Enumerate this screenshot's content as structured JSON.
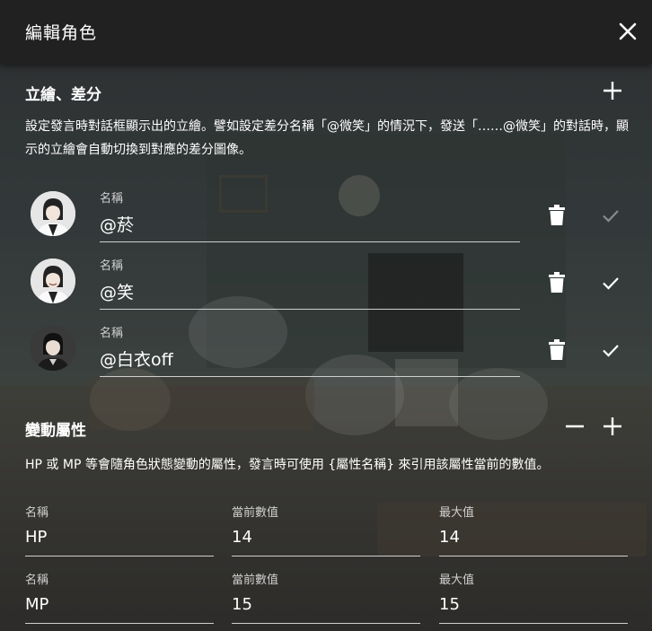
{
  "dialog": {
    "title": "編輯角色",
    "close_icon": "close-icon"
  },
  "sprites": {
    "title": "立繪、差分",
    "add_icon": "plus-icon",
    "description": "設定發言時對話框顯示出的立繪。譬如設定差分名稱「@微笑」的情況下，發送「……@微笑」的對話時，顯示的立繪會自動切換到對應的差分圖像。",
    "items": [
      {
        "label": "名稱",
        "value": "@菸",
        "check_active": false
      },
      {
        "label": "名稱",
        "value": "@笑",
        "check_active": true
      },
      {
        "label": "名稱",
        "value": "@白衣off",
        "check_active": true
      }
    ]
  },
  "attributes": {
    "title": "變動屬性",
    "remove_icon": "minus-icon",
    "add_icon": "plus-icon",
    "description": "HP 或 MP 等會隨角色狀態變動的屬性，發言時可使用 {屬性名稱} 來引用該屬性當前的數值。",
    "rows": [
      {
        "name_label": "名稱",
        "name": "HP",
        "current_label": "當前數值",
        "current": "14",
        "max_label": "最大值",
        "max": "14"
      },
      {
        "name_label": "名稱",
        "name": "MP",
        "current_label": "當前數值",
        "current": "15",
        "max_label": "最大值",
        "max": "15"
      }
    ]
  },
  "colors": {
    "header_bg": "#212121",
    "text": "#ffffff",
    "inactive_check": "#8a8a8a"
  }
}
